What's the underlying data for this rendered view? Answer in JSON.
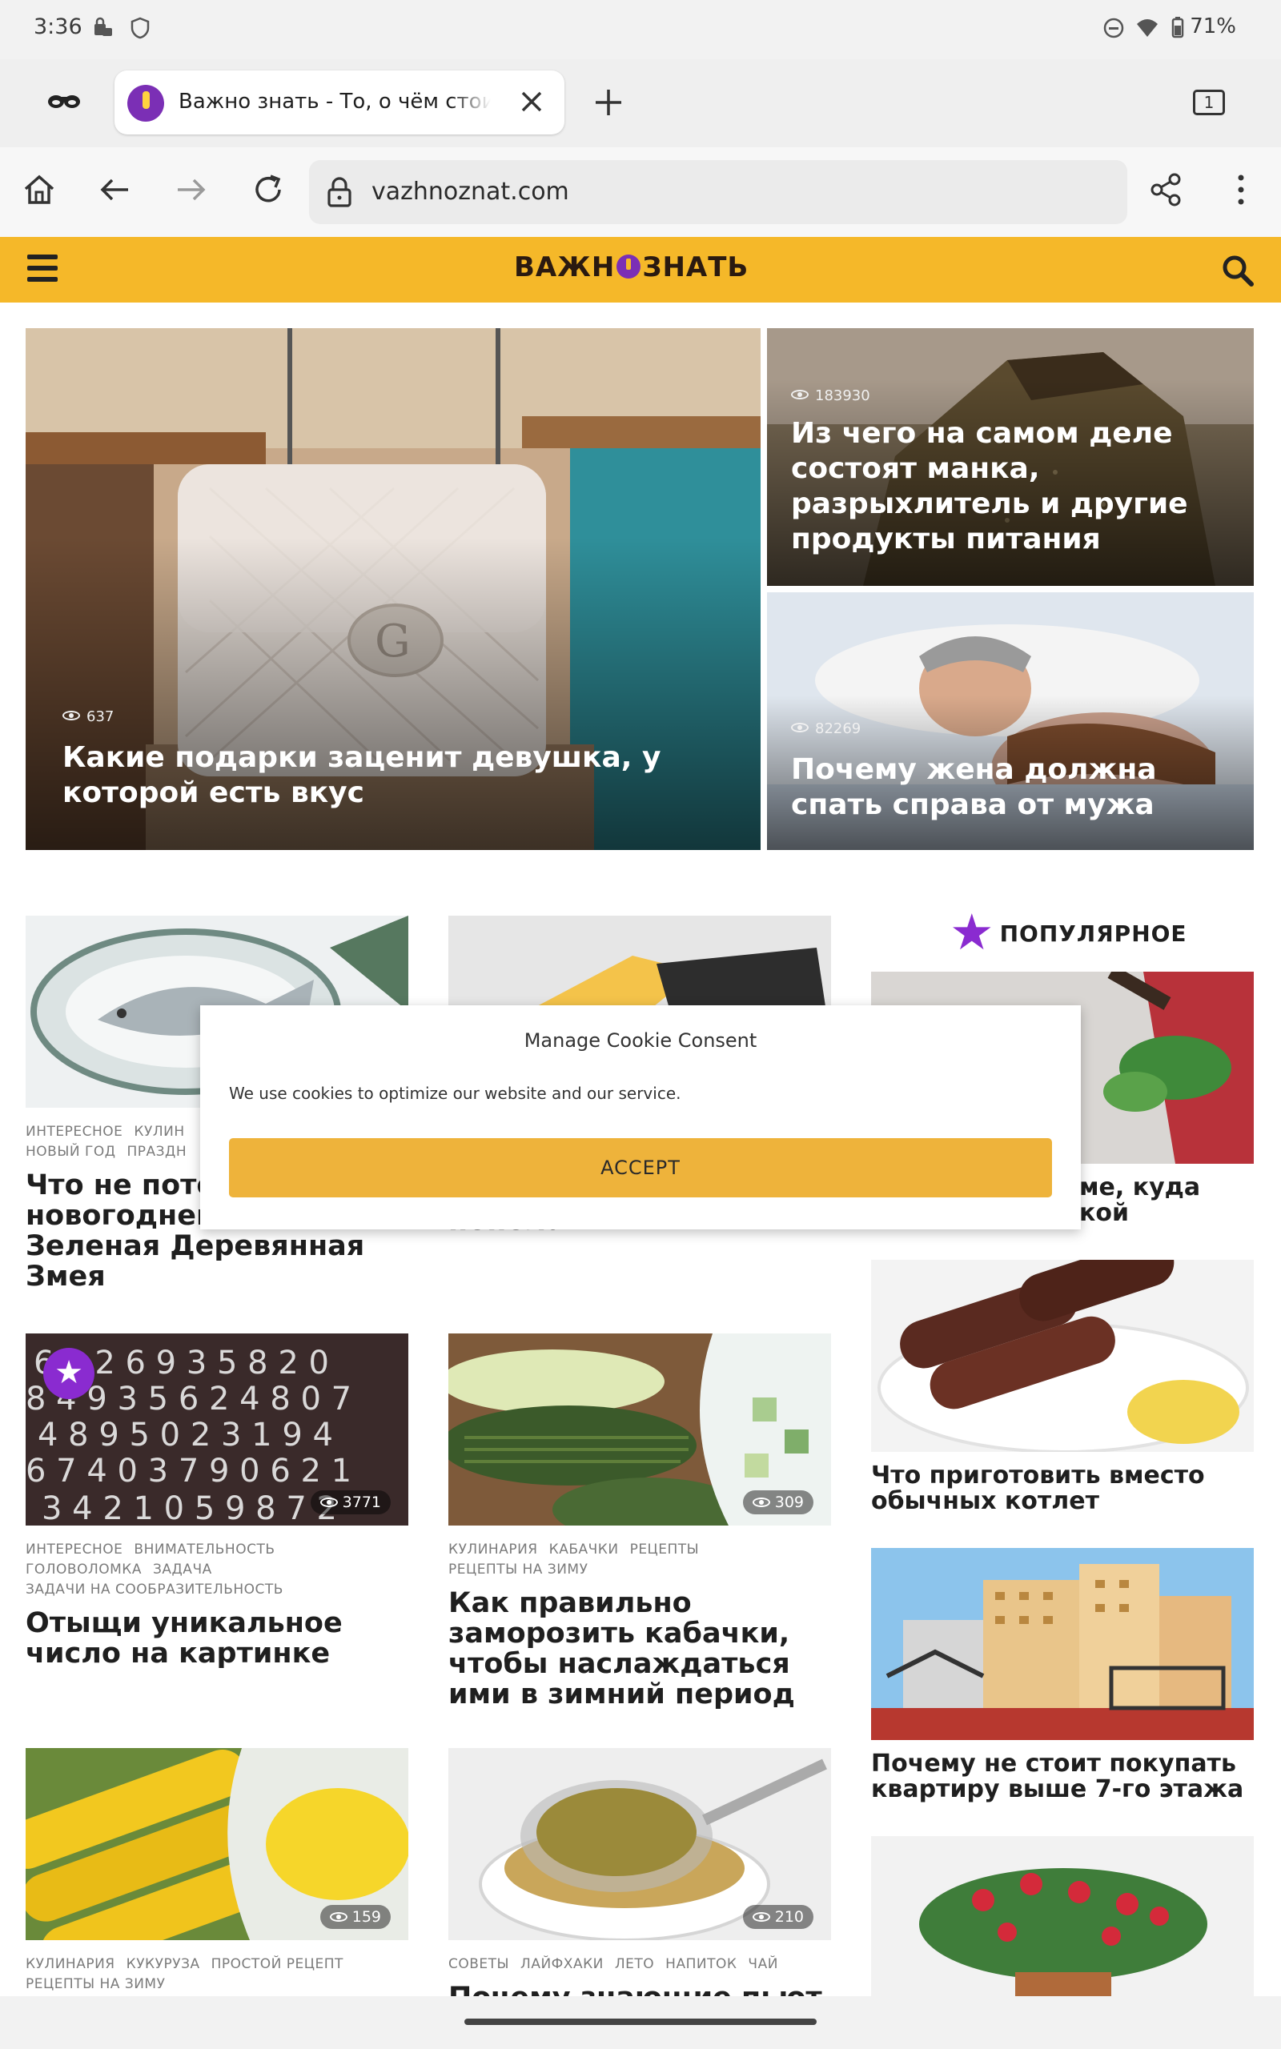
{
  "status": {
    "time": "3:36",
    "battery": "71%"
  },
  "tab": {
    "title": "Важно знать - То, о чём стоит знать"
  },
  "tabs_count": "1",
  "address": {
    "url": "vazhnoznat.com"
  },
  "site": {
    "logo_left": "ВАЖН",
    "logo_right": "ЗНАТЬ",
    "brand_color": "#f5b829",
    "accent_color": "#7b2fb5"
  },
  "hero": [
    {
      "views": "637",
      "title": "Какие подарки заценит девушка, у которой есть вкус"
    },
    {
      "views": "183930",
      "title": "Из чего на самом деле состоят манка, разрыхлитель и другие продукты питания"
    },
    {
      "views": "82269",
      "title": "Почему жена должна спать справа от мужа"
    }
  ],
  "cards": [
    {
      "tags": [
        "Интересное",
        "Кулин"
      ],
      "tags2": [
        "Новый год",
        "Праздн"
      ],
      "title_visible": "Что не поте",
      "title": [
        "Что не поте",
        "новогоднем",
        "Зеленая Деревянная",
        "Змея"
      ]
    },
    {
      "title": [
        "пополам"
      ]
    },
    {
      "views": "3771",
      "tags": [
        "Интересное",
        "Внимательность",
        "Головоломка",
        "Задача",
        "Задачи на сообразительность"
      ],
      "title": [
        "Отыщи уникальное",
        "число на картинке"
      ]
    },
    {
      "views": "309",
      "tags": [
        "Кулинария",
        "Кабачки",
        "Рецепты",
        "Рецепты на зиму"
      ],
      "title": [
        "Как правильно",
        "заморозить кабачки,",
        "чтобы наслаждаться",
        "ими в зимний период"
      ]
    },
    {
      "views": "159",
      "tags": [
        "Кулинария",
        "Кукуруза",
        "Простой рецепт",
        "Рецепты на зиму"
      ],
      "title": []
    },
    {
      "views": "210",
      "tags": [
        "Советы",
        "Лайфхаки",
        "Лето",
        "Напиток",
        "Чай"
      ],
      "title": [
        "Почему знающие пьют в"
      ]
    }
  ],
  "popular": {
    "heading": "ПОПУЛЯРНОЕ",
    "items": [
      {
        "title": [
          "ме, куда",
          "кой"
        ]
      },
      {
        "title": [
          "Что приготовить вместо",
          "обычных котлет"
        ]
      },
      {
        "title": [
          "Почему не стоит покупать",
          "квартиру выше 7-го этажа"
        ]
      },
      {
        "title": []
      }
    ]
  },
  "cookie": {
    "title": "Manage Cookie Consent",
    "text": "We use cookies to optimize our website and our service.",
    "accept": "ACCEPT"
  }
}
